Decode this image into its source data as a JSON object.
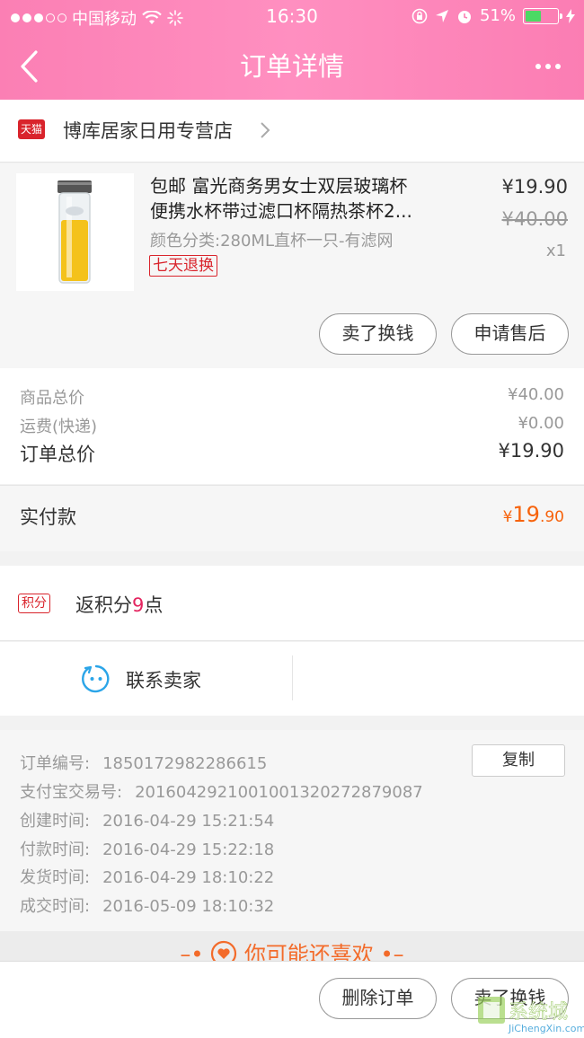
{
  "status_bar": {
    "carrier": "中国移动",
    "time": "16:30",
    "battery": "51%",
    "battery_level": 0.51
  },
  "nav": {
    "title": "订单详情",
    "back_icon": "chevron-left-icon",
    "more_icon": "more-dots-icon"
  },
  "shop": {
    "badge": "天猫",
    "name": "博库居家日用专营店"
  },
  "product": {
    "title_line1": "包邮 富光商务男女士双层玻璃杯",
    "title_line2": "便携水杯带过滤口杯隔热茶杯2...",
    "sku": "颜色分类:280ML直杯一只-有滤网",
    "tag": "七天退换",
    "price": "¥19.90",
    "original_price": "¥40.00",
    "quantity": "x1",
    "buttons": {
      "sell": "卖了换钱",
      "after_sale": "申请售后"
    }
  },
  "summary": {
    "goods_label": "商品总价",
    "goods_value": "¥40.00",
    "shipping_label": "运费(快递)",
    "shipping_value": "¥0.00",
    "total_label": "订单总价",
    "total_value": "¥19.90",
    "paid_label": "实付款",
    "paid_currency": "¥",
    "paid_int": "19",
    "paid_dec": ".90"
  },
  "points": {
    "badge": "积分",
    "text_prefix": "返积分",
    "number": "9",
    "text_suffix": "点"
  },
  "contact": {
    "label": "联系卖家"
  },
  "order_info": {
    "order_no_label": "订单编号:",
    "order_no": "1850172982286615",
    "copy_label": "复制",
    "alipay_label": "支付宝交易号:",
    "alipay_no": "2016042921001001320272879087",
    "created_label": "创建时间:",
    "created": "2016-04-29 15:21:54",
    "paid_label": "付款时间:",
    "paid": "2016-04-29 15:22:18",
    "shipped_label": "发货时间:",
    "shipped": "2016-04-29 18:10:22",
    "done_label": "成交时间:",
    "done": "2016-05-09 18:10:32"
  },
  "recommend": {
    "title": "你可能还喜欢"
  },
  "bottom_bar": {
    "delete": "删除订单",
    "sell": "卖了换钱"
  },
  "watermark": "JiChengXin.com",
  "colors": {
    "header": "#fb7fb4",
    "tmall_red": "#d9242c",
    "price_orange": "#f7630c",
    "points_pink": "#e4245f"
  }
}
